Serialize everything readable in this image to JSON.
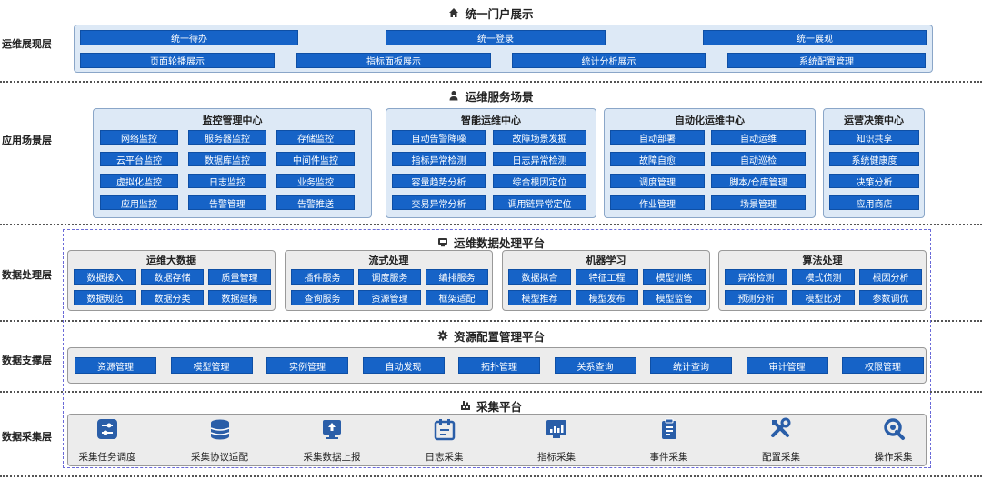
{
  "portal": {
    "title": "统一门户展示",
    "layer": "运维展现层",
    "row1": [
      "统一待办",
      "统一登录",
      "统一展现"
    ],
    "row2": [
      "页面轮播展示",
      "指标面板展示",
      "统计分析展示",
      "系统配置管理"
    ]
  },
  "services": {
    "title": "运维服务场景",
    "layer": "应用场景层",
    "monitor": {
      "title": "监控管理中心",
      "items": [
        "网络监控",
        "服务器监控",
        "存储监控",
        "云平台监控",
        "数据库监控",
        "中间件监控",
        "虚拟化监控",
        "日志监控",
        "业务监控",
        "应用监控",
        "告警管理",
        "告警推送"
      ]
    },
    "aiops": {
      "title": "智能运维中心",
      "items": [
        "自动告警降噪",
        "故障场景发掘",
        "指标异常检测",
        "日志异常检测",
        "容量趋势分析",
        "综合根因定位",
        "交易异常分析",
        "调用链异常定位"
      ]
    },
    "automation": {
      "title": "自动化运维中心",
      "items": [
        "自动部署",
        "自动运维",
        "故障自愈",
        "自动巡检",
        "调度管理",
        "脚本/仓库管理",
        "作业管理",
        "场景管理"
      ]
    },
    "decision": {
      "title": "运营决策中心",
      "items": [
        "知识共享",
        "系统健康度",
        "决策分析",
        "应用商店"
      ]
    }
  },
  "processing": {
    "title": "运维数据处理平台",
    "layer": "数据处理层",
    "bigdata": {
      "title": "运维大数据",
      "items": [
        "数据接入",
        "数据存储",
        "质量管理",
        "数据规范",
        "数据分类",
        "数据建模"
      ]
    },
    "stream": {
      "title": "流式处理",
      "items": [
        "插件服务",
        "调度服务",
        "编排服务",
        "查询服务",
        "资源管理",
        "框架适配"
      ]
    },
    "ml": {
      "title": "机器学习",
      "items": [
        "数据拟合",
        "特征工程",
        "模型训练",
        "模型推荐",
        "模型发布",
        "模型监管"
      ]
    },
    "algo": {
      "title": "算法处理",
      "items": [
        "异常检测",
        "模式侦测",
        "根因分析",
        "预测分析",
        "模型比对",
        "参数调优"
      ]
    }
  },
  "resource": {
    "title": "资源配置管理平台",
    "layer": "数据支撑层",
    "items": [
      "资源管理",
      "模型管理",
      "实例管理",
      "自动发现",
      "拓扑管理",
      "关系查询",
      "统计查询",
      "审计管理",
      "权限管理"
    ]
  },
  "collect": {
    "title": "采集平台",
    "layer": "数据采集层",
    "items": [
      {
        "label": "采集任务调度",
        "icon": "task-schedule-icon"
      },
      {
        "label": "采集协议适配",
        "icon": "protocol-adapter-icon"
      },
      {
        "label": "采集数据上报",
        "icon": "data-upload-icon"
      },
      {
        "label": "日志采集",
        "icon": "calendar-log-icon"
      },
      {
        "label": "指标采集",
        "icon": "metric-chart-icon"
      },
      {
        "label": "事件采集",
        "icon": "clipboard-event-icon"
      },
      {
        "label": "配置采集",
        "icon": "tools-config-icon"
      },
      {
        "label": "操作采集",
        "icon": "wrench-operation-icon"
      }
    ]
  },
  "colors": {
    "button": "#1663c7",
    "panel": "#dde9f6",
    "panel_border": "#8aa6c8",
    "icon": "#2a5ea8"
  }
}
